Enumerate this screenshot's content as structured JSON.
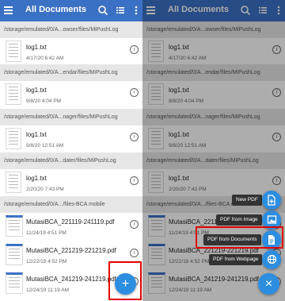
{
  "app": {
    "title": "All Documents"
  },
  "groups": [
    {
      "path": "/storage/emulated/0/A...owser/files/MiPushLog",
      "file": {
        "name": "log1.txt",
        "date": "4/17/20 6:42 AM"
      }
    },
    {
      "path": "/storage/emulated/0/A...endar/files/MiPushLog",
      "file": {
        "name": "log1.txt",
        "date": "9/8/20 4:04 PM"
      }
    },
    {
      "path": "/storage/emulated/0/A...nager/files/MiPushLog",
      "file": {
        "name": "log1.txt",
        "date": "9/8/20 12:51 AM"
      }
    },
    {
      "path": "/storage/emulated/0/A...dater/files/MiPushLog",
      "file": {
        "name": "log1.txt",
        "date": "2/20/20 7:43 PM"
      }
    }
  ],
  "bca_group": {
    "path": "/storage/emulated/0/A.../files-BCA mobile",
    "files": [
      {
        "name": "MutasiBCA_221119-241119.pdf",
        "date": "11/24/19 4:51 PM"
      },
      {
        "name": "MutasiBCA_221219-221219.pdf",
        "date": "12/22/19 4:52 PM"
      },
      {
        "name": "MutasiBCA_241219-241219.pdf",
        "date": "12/24/19 11:19 AM"
      }
    ]
  },
  "fab_menu": {
    "new_pdf": "New PDF",
    "pdf_from_image": "PDF from Image",
    "pdf_from_documents": "PDF from Documents",
    "pdf_from_webpage": "PDF from Webpage"
  },
  "symbols": {
    "info": "i",
    "plus": "+",
    "close": "×"
  },
  "icons": [
    "menu-icon",
    "search-icon",
    "list-view-icon",
    "more-vert-icon",
    "info-icon",
    "plus-icon",
    "close-icon",
    "new-pdf-icon",
    "image-icon",
    "document-icon",
    "webpage-icon"
  ],
  "colors": {
    "appbar": "#3b71c5",
    "fab": "#2d8ee0",
    "highlight": "#e00000",
    "path_bar": "#e6e6e6"
  }
}
